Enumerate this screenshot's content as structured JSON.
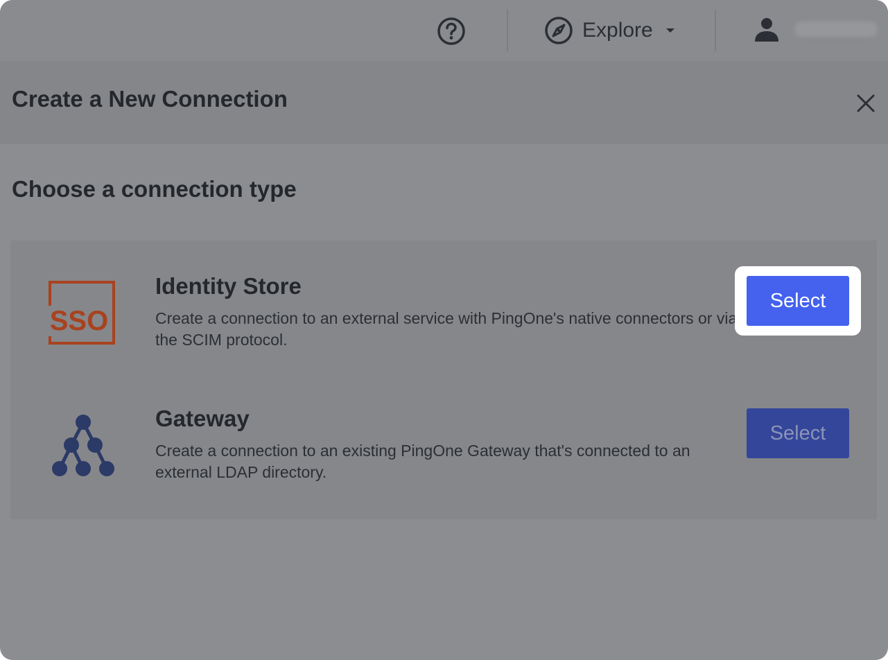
{
  "header": {
    "explore_label": "Explore",
    "icons": {
      "help": "help-circle-icon",
      "explore": "compass-icon",
      "explore_caret": "caret-down-icon",
      "user": "person-icon"
    }
  },
  "modal": {
    "title": "Create a New Connection",
    "close_icon": "close-icon",
    "section_title": "Choose a connection type",
    "options": [
      {
        "icon": "sso-icon",
        "icon_text": "SSO",
        "title": "Identity Store",
        "description": "Create a connection to an external service with PingOne's native connectors or via the SCIM protocol.",
        "button_label": "Select"
      },
      {
        "icon": "network-tree-icon",
        "title": "Gateway",
        "description": "Create a connection to an existing PingOne Gateway that's connected to an external LDAP directory.",
        "button_label": "Select"
      }
    ]
  },
  "colors": {
    "primary_button": "#4462ed",
    "sso_orange": "#a8421f",
    "gateway_navy": "#2b3a66"
  }
}
